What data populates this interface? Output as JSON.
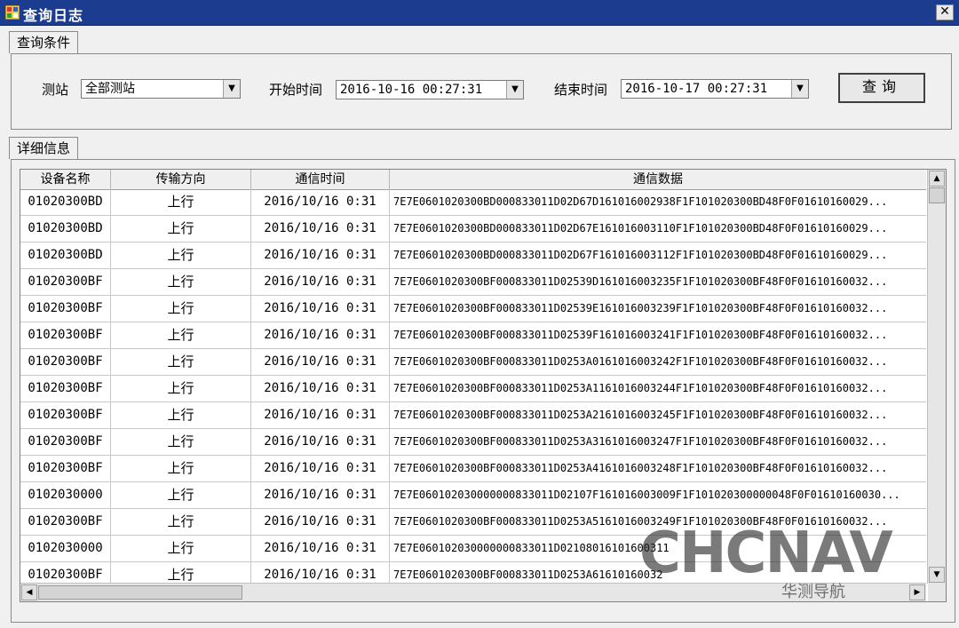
{
  "window": {
    "title": "查询日志",
    "close_glyph": "✕"
  },
  "conditions": {
    "tab_label": "查询条件",
    "station_label": "测站",
    "station_value": "全部测站",
    "start_label": "开始时间",
    "start_value": "2016-10-16 00:27:31",
    "end_label": "结束时间",
    "end_value": "2016-10-17 00:27:31",
    "query_button": "查询"
  },
  "details": {
    "tab_label": "详细信息"
  },
  "table": {
    "columns": [
      "设备名称",
      "传输方向",
      "通信时间",
      "通信数据"
    ],
    "rows": [
      [
        "01020300BD",
        "上行",
        "2016/10/16 0:31",
        "7E7E0601020300BD000833011D02D67D161016002938F1F101020300BD48F0F01610160029..."
      ],
      [
        "01020300BD",
        "上行",
        "2016/10/16 0:31",
        "7E7E0601020300BD000833011D02D67E161016003110F1F101020300BD48F0F01610160029..."
      ],
      [
        "01020300BD",
        "上行",
        "2016/10/16 0:31",
        "7E7E0601020300BD000833011D02D67F161016003112F1F101020300BD48F0F01610160029..."
      ],
      [
        "01020300BF",
        "上行",
        "2016/10/16 0:31",
        "7E7E0601020300BF000833011D02539D161016003235F1F101020300BF48F0F01610160032..."
      ],
      [
        "01020300BF",
        "上行",
        "2016/10/16 0:31",
        "7E7E0601020300BF000833011D02539E161016003239F1F101020300BF48F0F01610160032..."
      ],
      [
        "01020300BF",
        "上行",
        "2016/10/16 0:31",
        "7E7E0601020300BF000833011D02539F161016003241F1F101020300BF48F0F01610160032..."
      ],
      [
        "01020300BF",
        "上行",
        "2016/10/16 0:31",
        "7E7E0601020300BF000833011D0253A0161016003242F1F101020300BF48F0F01610160032..."
      ],
      [
        "01020300BF",
        "上行",
        "2016/10/16 0:31",
        "7E7E0601020300BF000833011D0253A1161016003244F1F101020300BF48F0F01610160032..."
      ],
      [
        "01020300BF",
        "上行",
        "2016/10/16 0:31",
        "7E7E0601020300BF000833011D0253A2161016003245F1F101020300BF48F0F01610160032..."
      ],
      [
        "01020300BF",
        "上行",
        "2016/10/16 0:31",
        "7E7E0601020300BF000833011D0253A3161016003247F1F101020300BF48F0F01610160032..."
      ],
      [
        "01020300BF",
        "上行",
        "2016/10/16 0:31",
        "7E7E0601020300BF000833011D0253A4161016003248F1F101020300BF48F0F01610160032..."
      ],
      [
        "0102030000",
        "上行",
        "2016/10/16 0:31",
        "7E7E060102030000000833011D02107F161016003009F1F101020300000048F0F01610160030..."
      ],
      [
        "01020300BF",
        "上行",
        "2016/10/16 0:31",
        "7E7E0601020300BF000833011D0253A5161016003249F1F101020300BF48F0F01610160032..."
      ],
      [
        "0102030000",
        "上行",
        "2016/10/16 0:31",
        "7E7E060102030000000833011D02108016101600311"
      ],
      [
        "01020300BF",
        "上行",
        "2016/10/16 0:31",
        "7E7E0601020300BF000833011D0253A61610160032"
      ]
    ]
  },
  "watermark": {
    "brand": "CHCNAV",
    "sub": "华测导航"
  },
  "colors": {
    "titlebar": "#1c3d8f",
    "window_bg": "#f0f0f0"
  }
}
